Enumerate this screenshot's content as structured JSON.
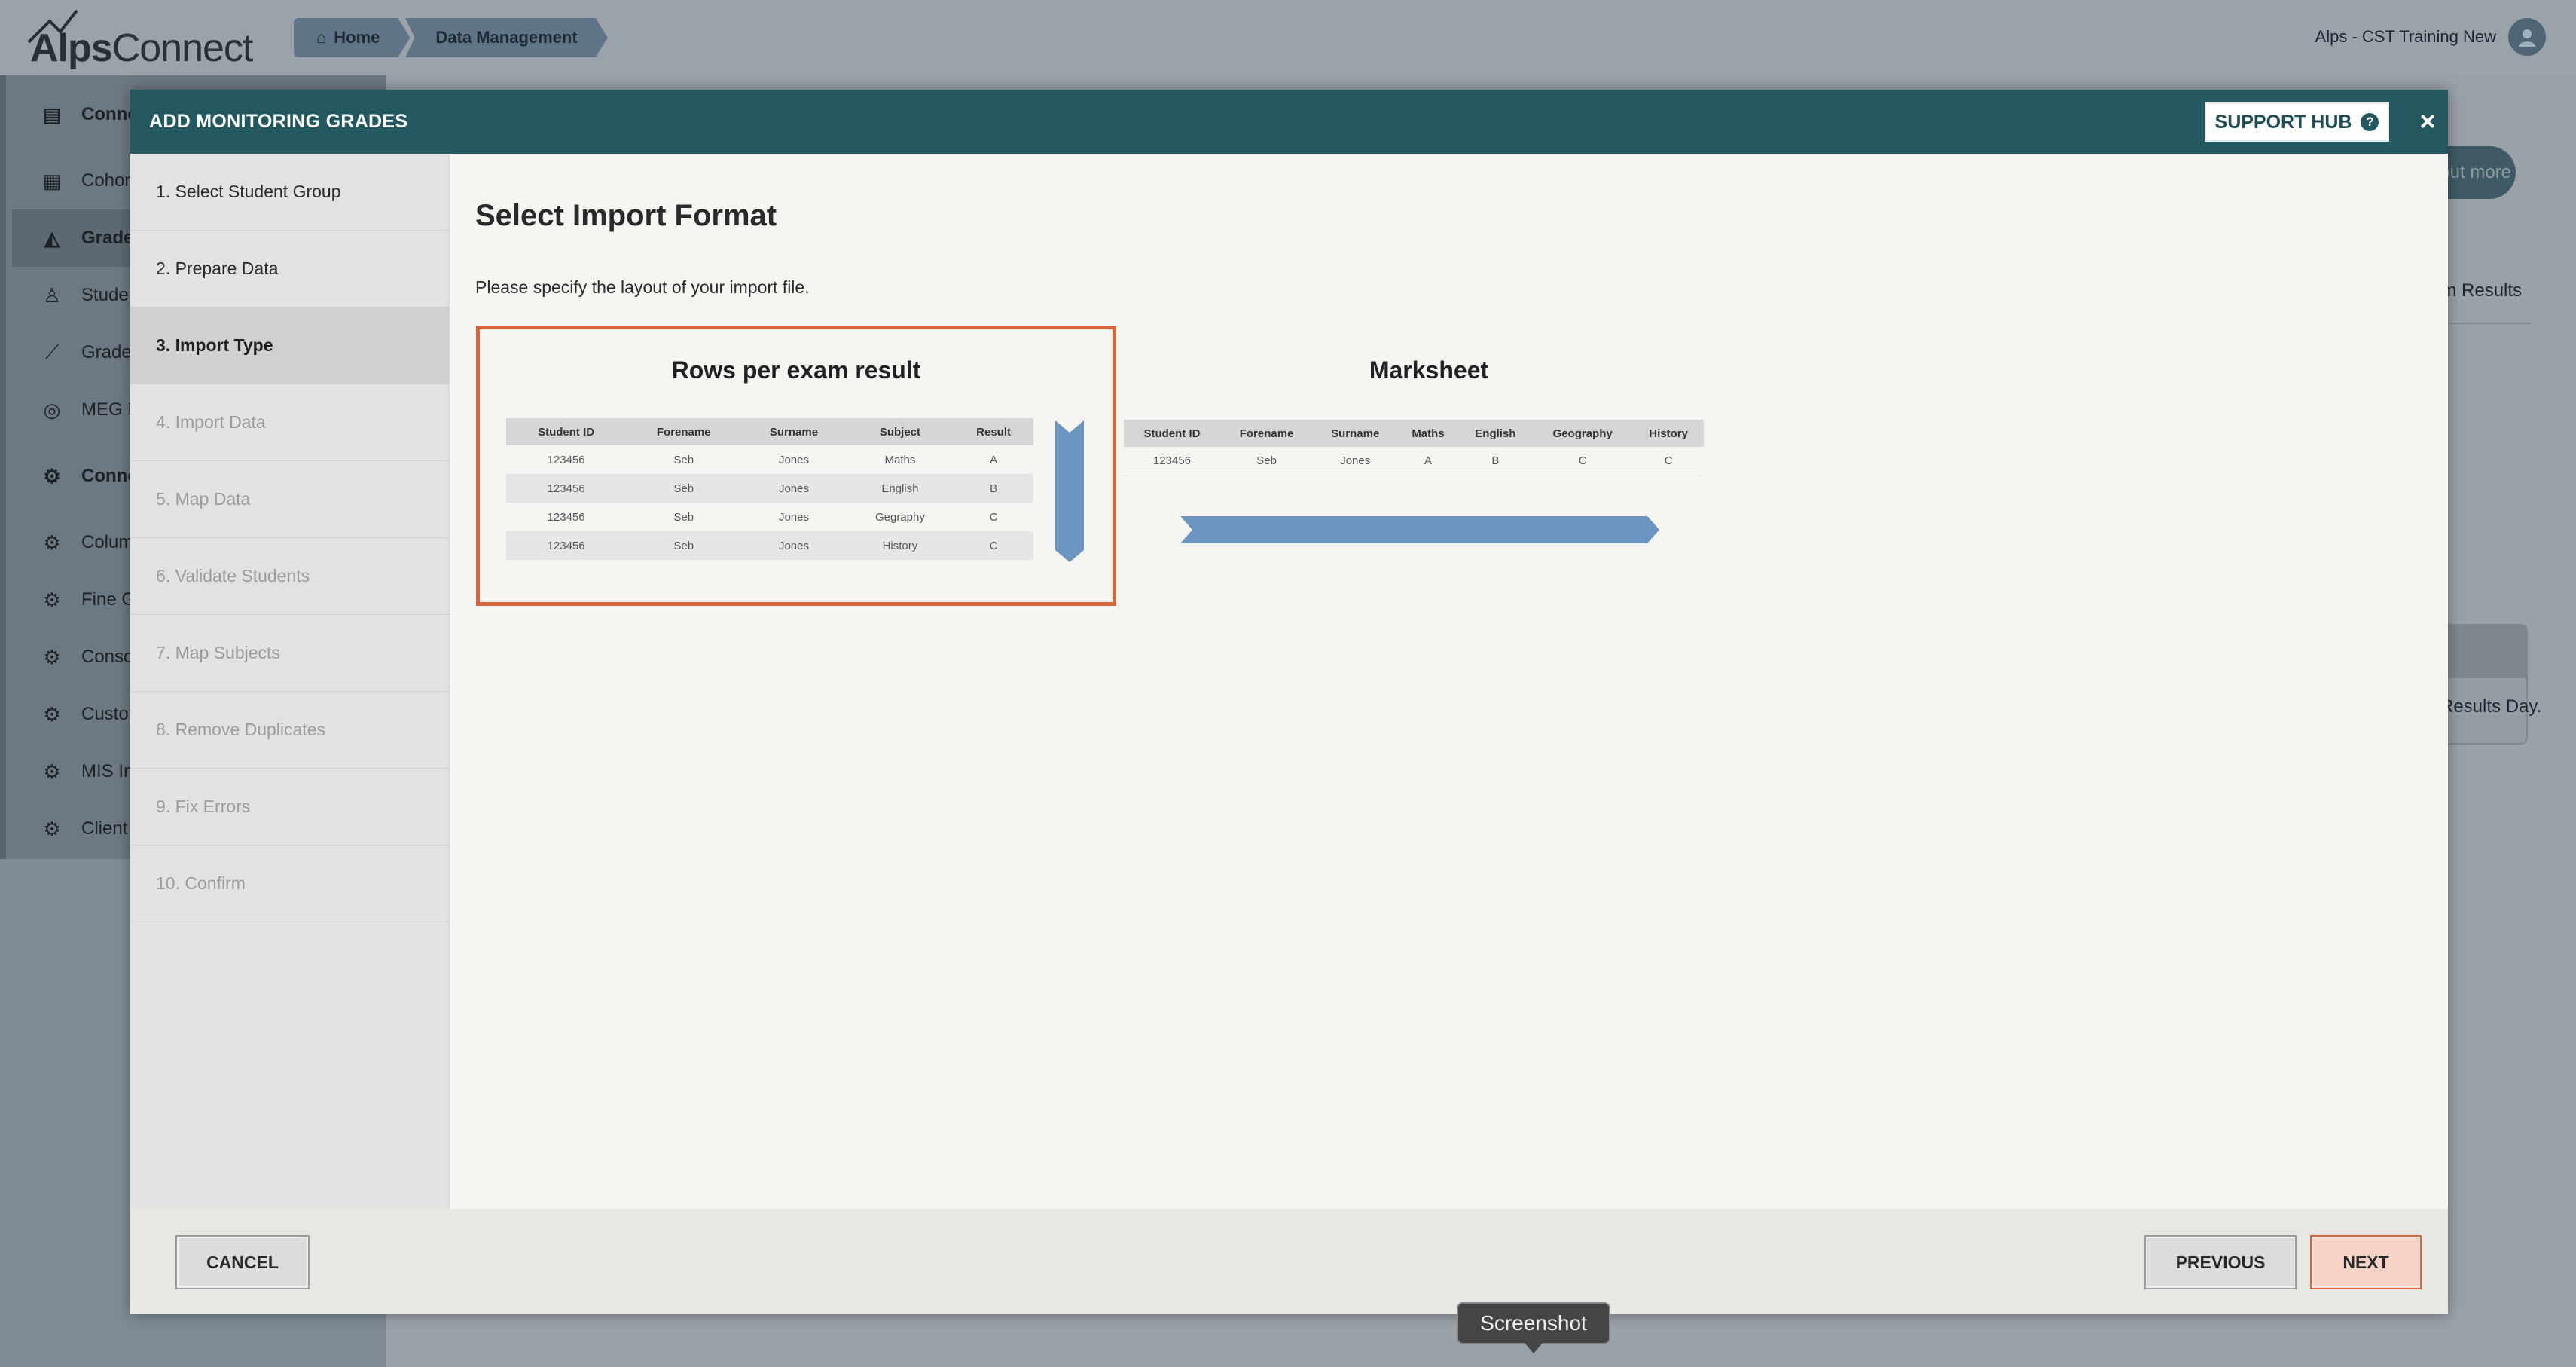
{
  "app": {
    "logo_bold": "Alps",
    "logo_light": "Connect",
    "breadcrumb": [
      "Home",
      "Data Management"
    ],
    "account_name": "Alps - CST Training New"
  },
  "sidebar": {
    "items": [
      {
        "label": "Connect Data",
        "icon": "database-icon"
      },
      {
        "label": "Cohorts",
        "icon": "table-icon"
      },
      {
        "label": "Grades",
        "icon": "graduation-cap-icon"
      },
      {
        "label": "Students",
        "icon": "student-icon"
      },
      {
        "label": "Grades Analysis",
        "icon": "chart-line-icon"
      },
      {
        "label": "MEG Reports",
        "icon": "target-icon"
      },
      {
        "label": "Connect Settings",
        "icon": "gear-icon"
      },
      {
        "label": "Column Mapping",
        "icon": "gear-icon"
      },
      {
        "label": "Fine Grades",
        "icon": "gear-icon"
      },
      {
        "label": "Consortium",
        "icon": "gear-icon"
      },
      {
        "label": "Custom Grades",
        "icon": "gear-icon"
      },
      {
        "label": "MIS Integration",
        "icon": "gear-icon"
      },
      {
        "label": "Client Settings",
        "icon": "gear-icon"
      }
    ]
  },
  "background": {
    "pill": "Find out more",
    "tab": "Exam Results",
    "box_text": "Results Day."
  },
  "modal": {
    "title": "ADD MONITORING GRADES",
    "support_label": "SUPPORT HUB",
    "close_glyph": "×",
    "steps": [
      {
        "label": "1. Select Student Group",
        "state": "done"
      },
      {
        "label": "2. Prepare Data",
        "state": "done"
      },
      {
        "label": "3. Import Type",
        "state": "active"
      },
      {
        "label": "4. Import Data",
        "state": "disabled"
      },
      {
        "label": "5. Map Data",
        "state": "disabled"
      },
      {
        "label": "6. Validate Students",
        "state": "disabled"
      },
      {
        "label": "7. Map Subjects",
        "state": "disabled"
      },
      {
        "label": "8. Remove Duplicates",
        "state": "disabled"
      },
      {
        "label": "9. Fix Errors",
        "state": "disabled"
      },
      {
        "label": "10. Confirm",
        "state": "disabled"
      }
    ],
    "heading": "Select Import Format",
    "description": "Please specify the layout of your import file.",
    "options": [
      {
        "title": "Rows per exam result",
        "selected": true,
        "columns": [
          "Student ID",
          "Forename",
          "Surname",
          "Subject",
          "Result"
        ],
        "rows": [
          [
            "123456",
            "Seb",
            "Jones",
            "Maths",
            "A"
          ],
          [
            "123456",
            "Seb",
            "Jones",
            "English",
            "B"
          ],
          [
            "123456",
            "Seb",
            "Jones",
            "Gegraphy",
            "C"
          ],
          [
            "123456",
            "Seb",
            "Jones",
            "History",
            "C"
          ]
        ]
      },
      {
        "title": "Marksheet",
        "selected": false,
        "columns": [
          "Student ID",
          "Forename",
          "Surname",
          "Maths",
          "English",
          "Geography",
          "History"
        ],
        "rows": [
          [
            "123456",
            "Seb",
            "Jones",
            "A",
            "B",
            "C",
            "C"
          ]
        ]
      }
    ],
    "buttons": {
      "cancel": "CANCEL",
      "previous": "PREVIOUS",
      "next": "NEXT"
    }
  },
  "tooltip": "Screenshot",
  "colors": {
    "header": "#235860",
    "selected_border": "#d8633d",
    "arrow": "#6b94c0",
    "next_bg": "#f7d3c7"
  }
}
